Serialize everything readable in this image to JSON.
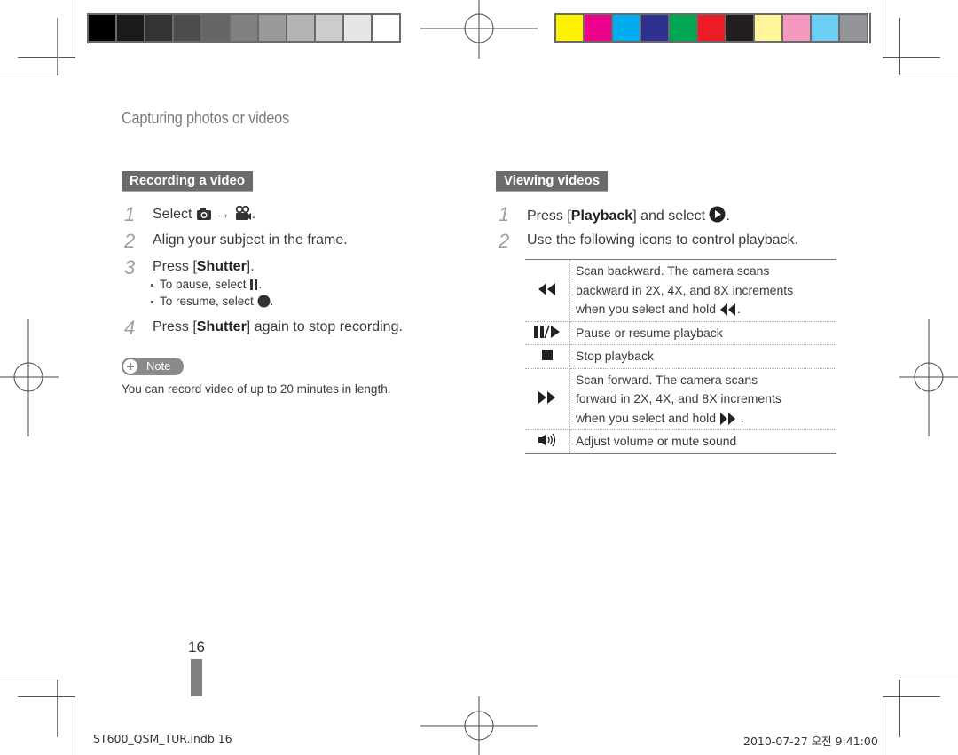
{
  "page": {
    "title": "Capturing photos or videos",
    "page_number": "16"
  },
  "print_marks": {
    "grayscale_swatches": [
      "#000000",
      "#1a1a1a",
      "#333333",
      "#4d4d4d",
      "#666666",
      "#808080",
      "#999999",
      "#b3b3b3",
      "#cccccc",
      "#e6e6e6",
      "#ffffff"
    ],
    "color_swatches": [
      "#fff200",
      "#ec008c",
      "#00aeef",
      "#2e3192",
      "#00a651",
      "#ed1c24",
      "#231f20",
      "#fff799",
      "#f49ac1",
      "#6dcff6",
      "#939598"
    ]
  },
  "recording": {
    "heading": "Recording a video",
    "steps": [
      {
        "num": "1",
        "pre": "Select ",
        "mid": " → ",
        "post": ".",
        "icons": [
          "camera-icon",
          "video-camera-icon"
        ]
      },
      {
        "num": "2",
        "text": "Align your subject in the frame."
      },
      {
        "num": "3",
        "pre": "Press [",
        "bold": "Shutter",
        "post": "]."
      },
      {
        "num": "4",
        "pre": "Press [",
        "bold": "Shutter",
        "post": "] again to stop recording."
      }
    ],
    "bullets": [
      {
        "text": "To pause, select ",
        "icon": "pause-icon",
        "post": "."
      },
      {
        "text": "To resume, select ",
        "icon": "record-dot-icon",
        "post": "."
      }
    ],
    "note_label": "Note",
    "note_text": "You can record video of up to 20 minutes in length."
  },
  "viewing": {
    "heading": "Viewing videos",
    "steps": [
      {
        "num": "1",
        "pre": "Press [",
        "bold": "Playback",
        "post": "] and select ",
        "post2": ".",
        "icon": "play-circle-icon"
      },
      {
        "num": "2",
        "text": "Use the following icons to control playback."
      }
    ],
    "controls": [
      {
        "icon": "rewind-icon",
        "lines": [
          "Scan backward. The camera scans",
          "backward in 2X, 4X, and 8X increments",
          "when you select and hold "
        ],
        "tail": "."
      },
      {
        "icon": "pause-play-icon",
        "lines": [
          "Pause or resume playback"
        ]
      },
      {
        "icon": "stop-icon",
        "lines": [
          "Stop playback"
        ]
      },
      {
        "icon": "fast-forward-icon",
        "lines": [
          "Scan forward. The camera scans",
          "forward in 2X, 4X, and 8X increments",
          "when you select and hold "
        ],
        "tail": " ."
      },
      {
        "icon": "volume-icon",
        "lines": [
          "Adjust volume or mute sound"
        ]
      }
    ]
  },
  "footer": {
    "file": "ST600_QSM_TUR.indb   16",
    "timestamp": "2010-07-27   오전 9:41:00"
  }
}
